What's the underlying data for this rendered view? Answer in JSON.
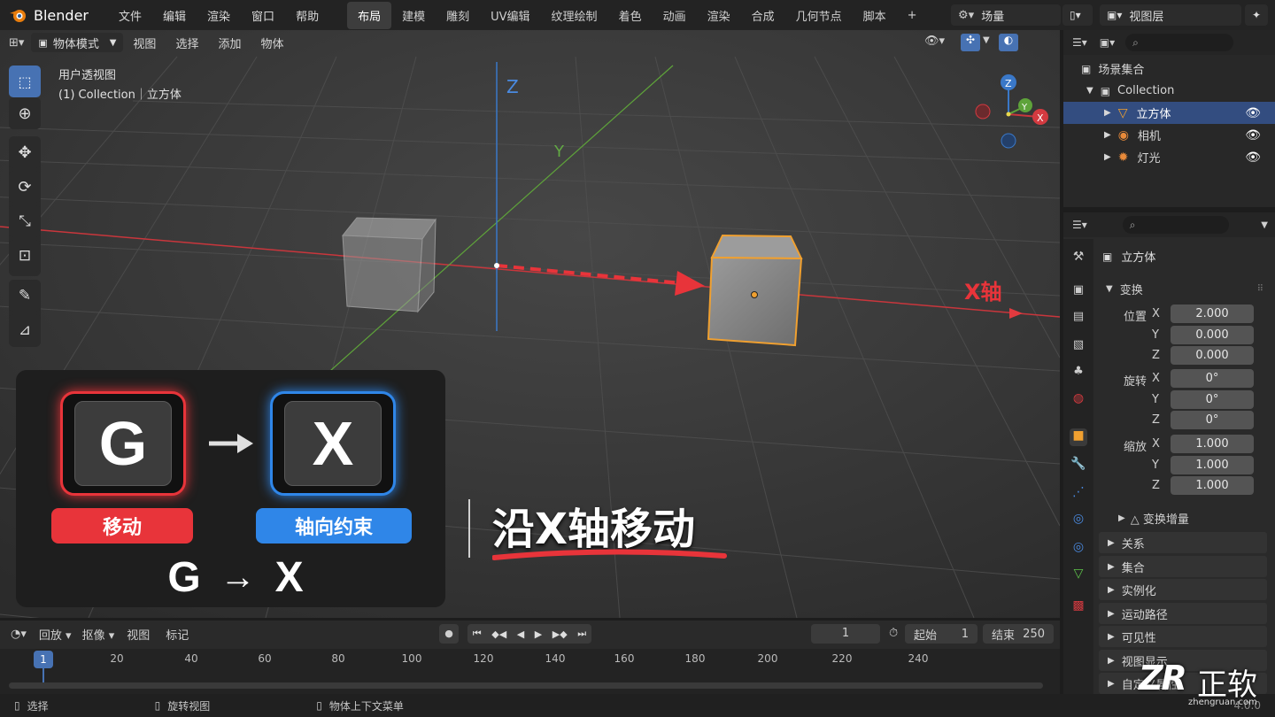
{
  "app": {
    "name": "Blender",
    "version": "4.0.0"
  },
  "menus": [
    "文件",
    "编辑",
    "渲染",
    "窗口",
    "帮助"
  ],
  "workspaces": [
    {
      "label": "布局",
      "active": true
    },
    {
      "label": "建模"
    },
    {
      "label": "雕刻"
    },
    {
      "label": "UV编辑"
    },
    {
      "label": "纹理绘制"
    },
    {
      "label": "着色"
    },
    {
      "label": "动画"
    },
    {
      "label": "渲染"
    },
    {
      "label": "合成"
    },
    {
      "label": "几何节点"
    },
    {
      "label": "脚本"
    }
  ],
  "add_workspace": "+",
  "scene": {
    "name": "场量",
    "view_layer": "视图层"
  },
  "viewport": {
    "mode": "物体模式",
    "menu": [
      "视图",
      "选择",
      "添加",
      "物体"
    ],
    "overlay_title": "用户透视图",
    "overlay_collection": "(1) Collection｜立方体",
    "axis_z": "Z",
    "axis_y": "Y",
    "axis_x_label": "X轴",
    "gizmo": {
      "x": "X",
      "y": "Y",
      "z": "Z"
    }
  },
  "tutorial": {
    "key1": "G",
    "key2": "X",
    "pill1": "移动",
    "pill2": "轴向约束",
    "combo_from": "G",
    "combo_arrow": "→",
    "combo_to": "X",
    "caption": "沿X轴移动",
    "colors": {
      "red": "#e8343a",
      "blue": "#2f86e8"
    }
  },
  "outliner": {
    "root": "场景集合",
    "collection": "Collection",
    "items": [
      {
        "label": "立方体",
        "selected": true,
        "icon": "mesh-icon"
      },
      {
        "label": "相机",
        "icon": "camera-icon"
      },
      {
        "label": "灯光",
        "icon": "light-icon"
      }
    ]
  },
  "properties": {
    "object": "立方体",
    "panel": "变换",
    "location": {
      "label": "位置",
      "x": "2.000",
      "y": "0.000",
      "z": "0.000"
    },
    "rotation": {
      "label": "旋转",
      "x": "0°",
      "y": "0°",
      "z": "0°"
    },
    "scale": {
      "label": "缩放",
      "x": "1.000",
      "y": "1.000",
      "z": "1.000"
    },
    "axis": {
      "x": "X",
      "y": "Y",
      "z": "Z"
    },
    "delta": "△ 变换增量",
    "panels": [
      "关系",
      "集合",
      "实例化",
      "运动路径",
      "可见性",
      "视图显示",
      "自定义属性"
    ]
  },
  "timeline": {
    "menu": [
      "回放",
      "抠像",
      "视图",
      "标记"
    ],
    "current": "1",
    "start_label": "起始",
    "start": "1",
    "end_label": "结束",
    "end": "250",
    "ruler": [
      "20",
      "40",
      "60",
      "80",
      "100",
      "120",
      "140",
      "160",
      "180",
      "200",
      "220",
      "240"
    ],
    "frame": "1"
  },
  "status": {
    "select": "选择",
    "rotate": "旋转视图",
    "context": "物体上下文菜单"
  },
  "watermark": {
    "brand": "ZR",
    "text": "正软",
    "url": "zhengruan.com"
  }
}
